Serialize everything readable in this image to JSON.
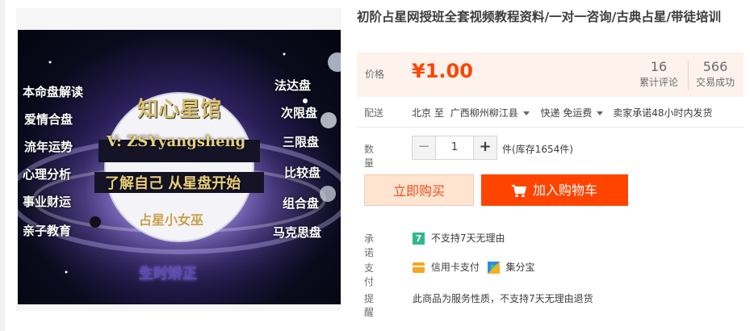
{
  "product": {
    "title": "初阶占星网授班全套视频教程资料/一对一咨询/古典占星/带徒培训"
  },
  "image": {
    "labels_left": [
      "本命盘解读",
      "爱情合盘",
      "流年运势",
      "心理分析",
      "事业财运",
      "亲子教育"
    ],
    "labels_right": [
      "法达盘",
      "次限盘",
      "三限盘",
      "比较盘",
      "组合盘",
      "马克思盘"
    ],
    "center_title": "知心星馆",
    "center_id": "V: ZSYyangsheng",
    "center_slogan": "了解自己 从星盘开始",
    "center_sub": "占星小女巫",
    "bottom_text": "生时矫正"
  },
  "price": {
    "label": "价格",
    "currency": "¥",
    "value": "1.00",
    "reviews_count": "16",
    "reviews_label": "累计评论",
    "deals_count": "566",
    "deals_label": "交易成功"
  },
  "shipping": {
    "label": "配送",
    "from": "北京",
    "to_word": "至",
    "destination": "广西柳州柳江县",
    "method": "快递 免运费",
    "promise": "卖家承诺48小时内发货"
  },
  "quantity": {
    "label": "数量",
    "minus": "−",
    "value": "1",
    "plus": "+",
    "stock": "件(库存1654件)"
  },
  "actions": {
    "buy_now": "立即购买",
    "add_cart": "加入购物车"
  },
  "guarantee": {
    "label": "承诺",
    "badge": "7",
    "text": "不支持7天无理由"
  },
  "payment": {
    "label": "支付",
    "credit": "信用卡支付",
    "jifen": "集分宝"
  },
  "reminder": {
    "label": "提醒",
    "text": "此商品为服务性质，不支持7天无理由退货"
  },
  "colors": {
    "accent": "#ff4400",
    "price_bg": "#fef2ec",
    "buy_bg": "#ffe4d0"
  }
}
